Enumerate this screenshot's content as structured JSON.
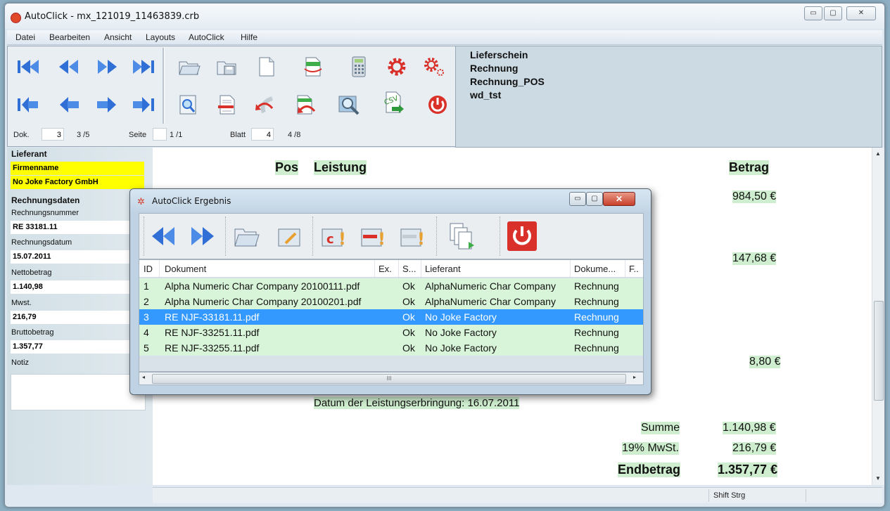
{
  "window": {
    "title": "AutoClick - mx_121019_11463839.crb",
    "controls": [
      "▭",
      "▢",
      "✕"
    ]
  },
  "menu": [
    "Datei",
    "Bearbeiten",
    "Ansicht",
    "Layouts",
    "AutoClick",
    "Hilfe"
  ],
  "doc_list": [
    "Lieferschein",
    "Rechnung",
    "Rechnung_POS",
    "wd_tst"
  ],
  "nav": {
    "dok_label": "Dok.",
    "dok_value": "3",
    "dok_count": "3 /5",
    "seite_label": "Seite",
    "seite_value": "1 /1",
    "blatt_label": "Blatt",
    "blatt_value": "4",
    "blatt_count": "4 /8"
  },
  "left": {
    "lieferant_group": "Lieferant",
    "firmenname_label": "Firmenname",
    "firmenname_value": "No Joke Factory GmbH",
    "rechnungsdaten_group": "Rechnungsdaten",
    "fields": [
      {
        "label": "Rechnungsnummer",
        "value": "RE 33181.11"
      },
      {
        "label": "Rechnungsdatum",
        "value": "15.07.2011"
      },
      {
        "label": "Nettobetrag",
        "value": "1.140,98"
      },
      {
        "label": "Mwst.",
        "value": "216,79"
      },
      {
        "label": "Bruttobetrag",
        "value": "1.357,77"
      }
    ],
    "notiz_label": "Notiz"
  },
  "document": {
    "col_pos": "Pos",
    "col_leistung": "Leistung",
    "col_betrag": "Betrag",
    "betrag_1": "984,50 €",
    "betrag_2": "147,68 €",
    "betrag_3": "8,80 €",
    "datum": "Datum der Leistungserbringung:  16.07.2011",
    "summe_label": "Summe",
    "summe_value": "1.140,98 €",
    "mwst_label": "19% MwSt.",
    "mwst_value": "216,79 €",
    "end_label": "Endbetrag",
    "end_value": "1.357,77 €"
  },
  "status": {
    "text": "Shift Strg"
  },
  "dialog": {
    "title": "AutoClick Ergebnis",
    "columns": [
      "ID",
      "Dokument",
      "Ex.",
      "S...",
      "Lieferant",
      "Dokume...",
      "F.."
    ],
    "rows": [
      {
        "id": "1",
        "dokument": "Alpha Numeric Char Company 20100111.pdf",
        "ex": "",
        "s": "Ok",
        "lieferant": "AlphaNumeric Char Company",
        "dokumenttyp": "Rechnung"
      },
      {
        "id": "2",
        "dokument": "Alpha Numeric Char Company 20100201.pdf",
        "ex": "",
        "s": "Ok",
        "lieferant": "AlphaNumeric Char Company",
        "dokumenttyp": "Rechnung"
      },
      {
        "id": "3",
        "dokument": "RE NJF-33181.11.pdf",
        "ex": "",
        "s": "Ok",
        "lieferant": "No Joke Factory",
        "dokumenttyp": "Rechnung"
      },
      {
        "id": "4",
        "dokument": "RE NJF-33251.11.pdf",
        "ex": "",
        "s": "Ok",
        "lieferant": "No Joke Factory",
        "dokumenttyp": "Rechnung"
      },
      {
        "id": "5",
        "dokument": "RE NJF-33255.11.pdf",
        "ex": "",
        "s": "Ok",
        "lieferant": "No Joke Factory",
        "dokumenttyp": "Rechnung"
      }
    ],
    "selected_row": "3",
    "scroll_grip": "III",
    "toolbar_icons": [
      "previous-icon",
      "next-icon",
      "open-folder-icon",
      "edit-folder-icon",
      "error-c-icon",
      "error-star-icon",
      "error-icon",
      "copy-pages-icon",
      "power-icon"
    ]
  },
  "colors": {
    "accent": "#3399ff",
    "highlight_yellow": "#ffff00",
    "row_green": "#d9f5d9",
    "nav_blue": "#2f6fd6",
    "red": "#d9302a"
  }
}
